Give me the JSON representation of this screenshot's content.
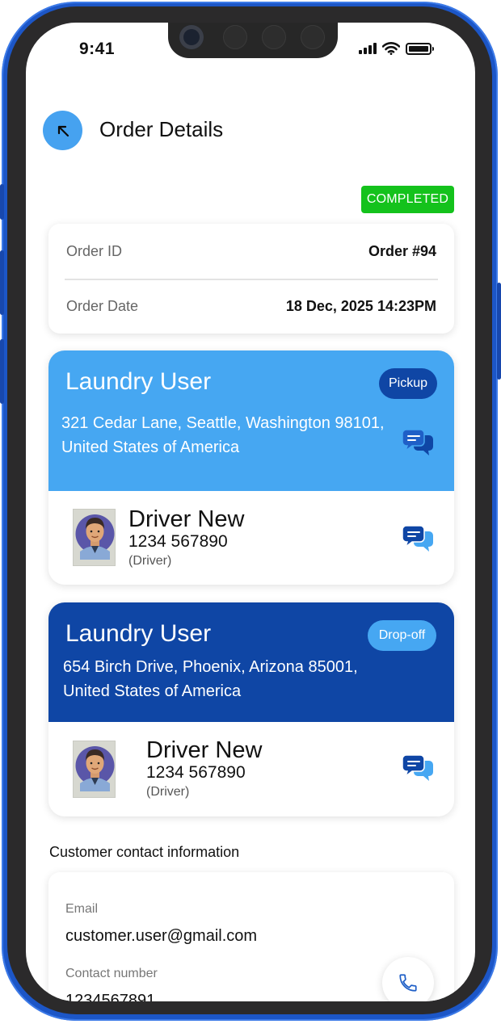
{
  "status_bar": {
    "time": "9:41"
  },
  "header": {
    "title": "Order Details",
    "back_icon": "arrow-up-left-icon"
  },
  "order": {
    "status": "COMPLETED",
    "status_color": "#14c21c",
    "id_label": "Order ID",
    "id_value": "Order #94",
    "date_label": "Order Date",
    "date_value": "18 Dec, 2025 14:23PM"
  },
  "pickup": {
    "name": "Laundry User",
    "type": "Pickup",
    "address": "321 Cedar Lane, Seattle, Washington 98101, United States of America",
    "header_color": "#46a7f2",
    "driver": {
      "name": "Driver New",
      "phone": "1234 567890",
      "role": "(Driver)"
    }
  },
  "dropoff": {
    "name": "Laundry User",
    "type": "Drop-off",
    "address": "654 Birch Drive, Phoenix, Arizona 85001, United States of America",
    "header_color": "#0f46a5",
    "driver": {
      "name": "Driver New",
      "phone": "1234 567890",
      "role": "(Driver)"
    }
  },
  "contact": {
    "section_title": "Customer contact information",
    "email_label": "Email",
    "email_value": "customer.user@gmail.com",
    "phone_label": "Contact number",
    "phone_value": "1234567891"
  }
}
